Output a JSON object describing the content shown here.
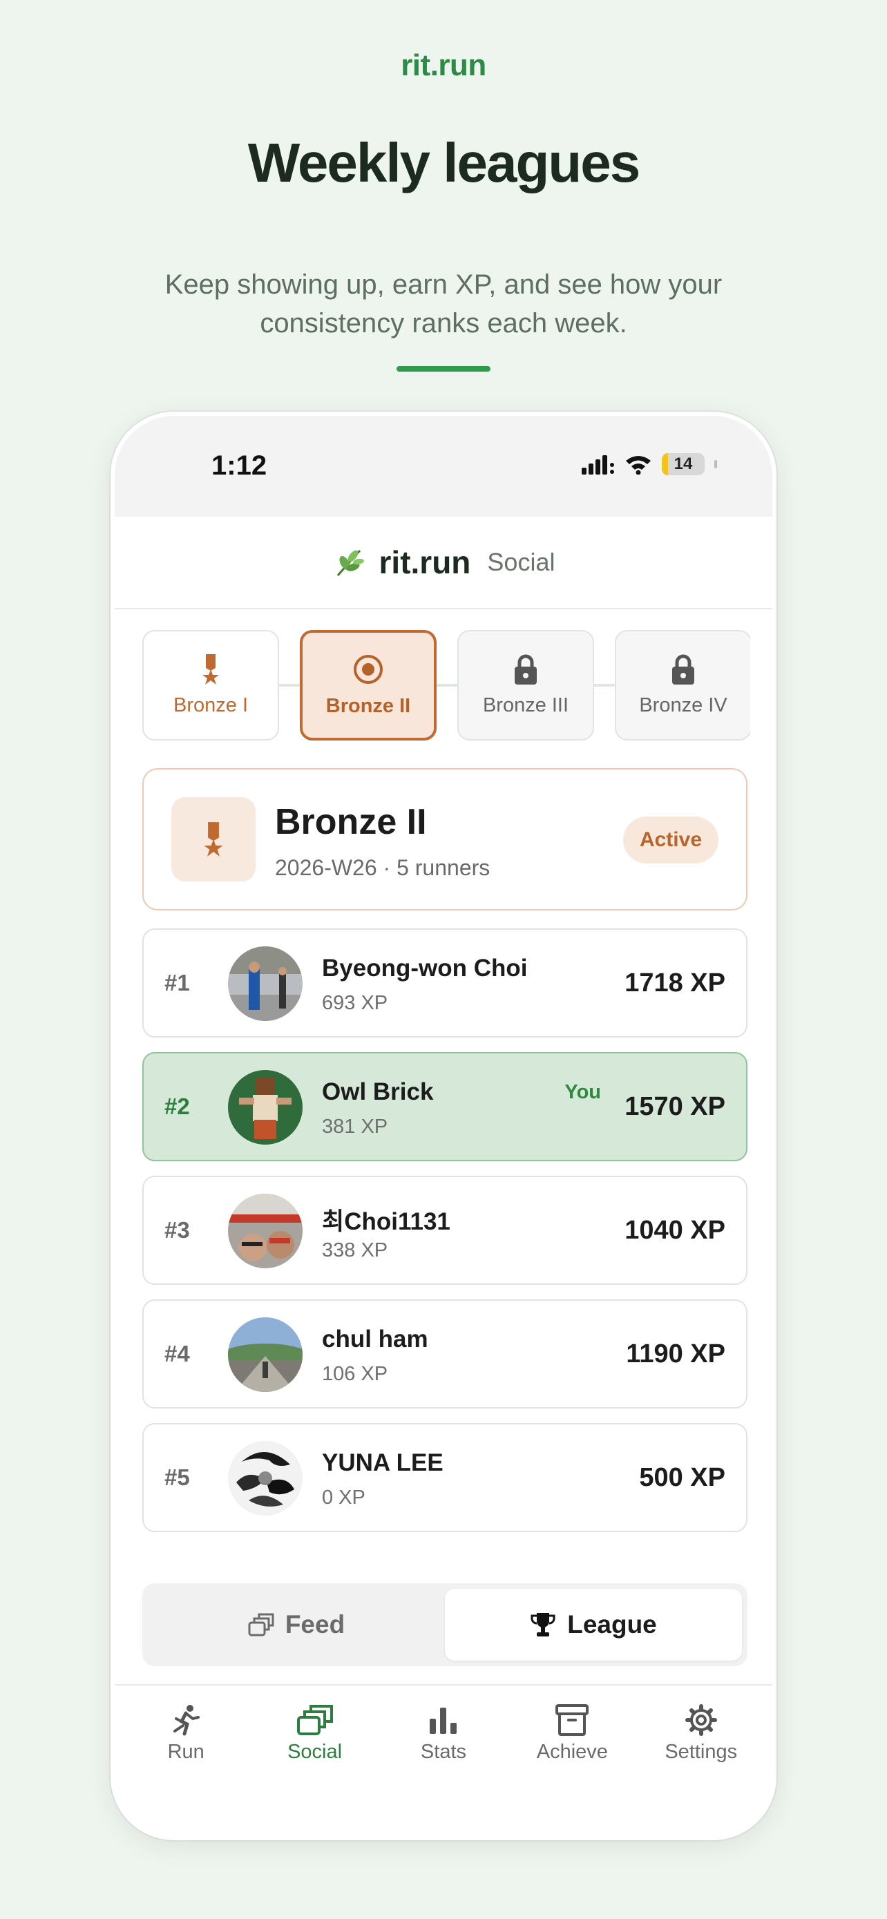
{
  "promo": {
    "brand": "rit.run",
    "headline": "Weekly leagues",
    "subline": "Keep showing up, earn XP, and see how your consistency ranks each week."
  },
  "status_bar": {
    "time": "1:12",
    "battery": "14",
    "icons": [
      "cellular-signal-icon",
      "wifi-icon",
      "battery-icon"
    ]
  },
  "header": {
    "logo_icon": "leaf-icon",
    "brand": "rit.run",
    "section": "Social"
  },
  "tiers": [
    {
      "label": "Bronze I",
      "state": "unlocked",
      "icon": "medal-icon"
    },
    {
      "label": "Bronze II",
      "state": "current",
      "icon": "target-icon"
    },
    {
      "label": "Bronze III",
      "state": "locked",
      "icon": "lock-icon"
    },
    {
      "label": "Bronze IV",
      "state": "locked",
      "icon": "lock-icon"
    }
  ],
  "league": {
    "icon": "medal-icon",
    "name": "Bronze II",
    "meta": "2026-W26 · 5 runners",
    "status": "Active"
  },
  "rankings": [
    {
      "rank": "#1",
      "name": "Byeong-won Choi",
      "sub": "693 XP",
      "xp": "1718 XP",
      "you": false
    },
    {
      "rank": "#2",
      "name": "Owl Brick",
      "sub": "381 XP",
      "xp": "1570 XP",
      "you": true,
      "you_label": "You"
    },
    {
      "rank": "#3",
      "name": "최Choi1131",
      "sub": "338 XP",
      "xp": "1040 XP",
      "you": false
    },
    {
      "rank": "#4",
      "name": "chul ham",
      "sub": "106 XP",
      "xp": "1190 XP",
      "you": false
    },
    {
      "rank": "#5",
      "name": "YUNA LEE",
      "sub": "0 XP",
      "xp": "500 XP",
      "you": false
    }
  ],
  "segment": {
    "feed": "Feed",
    "league": "League",
    "selected": "League"
  },
  "tabbar": [
    {
      "label": "Run",
      "icon": "runner-icon"
    },
    {
      "label": "Social",
      "icon": "social-cards-icon"
    },
    {
      "label": "Stats",
      "icon": "bar-chart-icon"
    },
    {
      "label": "Achieve",
      "icon": "archive-box-icon"
    },
    {
      "label": "Settings",
      "icon": "gear-icon"
    }
  ],
  "tabbar_selected": "Social",
  "colors": {
    "page_bg": "#eef5ee",
    "brand_green": "#2e8b47",
    "bronze": "#c06a30",
    "you_row_bg": "#d6e8d8"
  }
}
